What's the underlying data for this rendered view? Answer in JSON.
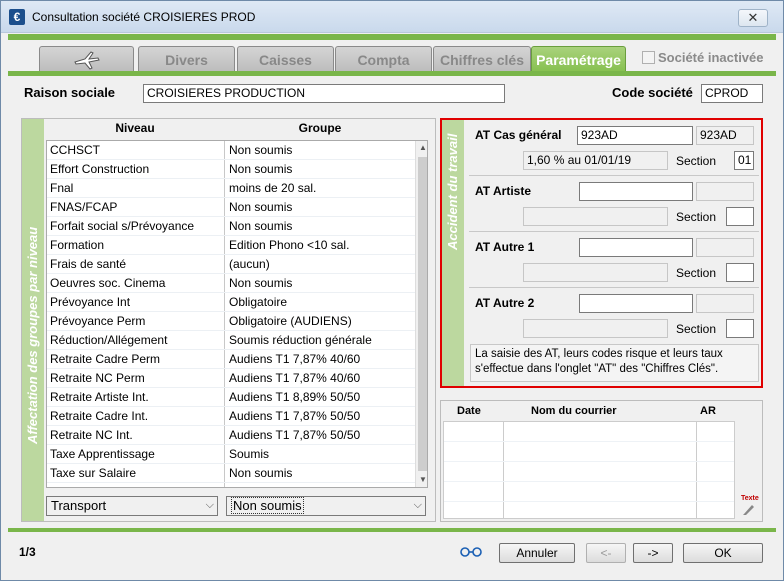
{
  "window": {
    "title": "Consultation société CROISIERES PROD",
    "close_glyph": "✕",
    "app_icon_glyph": "€"
  },
  "tabs": [
    {
      "label": ""
    },
    {
      "label": "Divers"
    },
    {
      "label": "Caisses"
    },
    {
      "label": "Compta"
    },
    {
      "label": "Chiffres clés"
    },
    {
      "label": "Paramétrage"
    }
  ],
  "societe_inactive_label": "Société inactivée",
  "header": {
    "raison_sociale_label": "Raison sociale",
    "raison_sociale_value": "CROISIERES PRODUCTION",
    "code_societe_label": "Code société",
    "code_societe_value": "CPROD"
  },
  "affectation": {
    "side_label": "Affectation des groupes par niveau",
    "col_niveau": "Niveau",
    "col_groupe": "Groupe",
    "rows": [
      {
        "niveau": "CCHSCT",
        "groupe": "Non soumis"
      },
      {
        "niveau": "Effort Construction",
        "groupe": "Non soumis"
      },
      {
        "niveau": "Fnal",
        "groupe": "moins de 20 sal."
      },
      {
        "niveau": "FNAS/FCAP",
        "groupe": "Non soumis"
      },
      {
        "niveau": "Forfait social s/Prévoyance",
        "groupe": "Non soumis"
      },
      {
        "niveau": "Formation",
        "groupe": "Edition Phono <10 sal."
      },
      {
        "niveau": "Frais de santé",
        "groupe": "(aucun)"
      },
      {
        "niveau": "Oeuvres soc. Cinema",
        "groupe": "Non soumis"
      },
      {
        "niveau": "Prévoyance Int",
        "groupe": "Obligatoire"
      },
      {
        "niveau": "Prévoyance Perm",
        "groupe": "Obligatoire (AUDIENS)"
      },
      {
        "niveau": "Réduction/Allégement",
        "groupe": "Soumis réduction générale"
      },
      {
        "niveau": "Retraite  Cadre Perm",
        "groupe": "Audiens T1 7,87% 40/60"
      },
      {
        "niveau": "Retraite  NC Perm",
        "groupe": "Audiens T1 7,87% 40/60"
      },
      {
        "niveau": "Retraite Artiste Int.",
        "groupe": "Audiens T1 8,89% 50/50"
      },
      {
        "niveau": "Retraite Cadre Int.",
        "groupe": "Audiens T1 7,87% 50/50"
      },
      {
        "niveau": "Retraite NC Int.",
        "groupe": "Audiens T1 7,87% 50/50"
      },
      {
        "niveau": "Taxe Apprentissage",
        "groupe": "Soumis"
      },
      {
        "niveau": "Taxe sur Salaire",
        "groupe": "Non soumis"
      },
      {
        "niveau": "Transport",
        "groupe": ""
      }
    ],
    "selected_niveau": "Transport",
    "selected_groupe": "Non soumis"
  },
  "accident": {
    "side_label": "Accident du travail",
    "cas_general_label": "AT Cas général",
    "cas_general_code": "923AD",
    "cas_general_code2": "923AD",
    "cas_general_taux": "1,60 % au 01/01/19",
    "section_label": "Section",
    "cas_general_section": "01",
    "artiste_label": "AT Artiste",
    "autre1_label": "AT Autre 1",
    "autre2_label": "AT Autre 2",
    "note": "La saisie des AT, leurs codes risque et leurs taux s'effectue dans l'onglet \"AT\" des \"Chiffres Clés\"."
  },
  "courrier": {
    "col_date": "Date",
    "col_nom": "Nom du courrier",
    "col_ar": "AR",
    "texte_label": "Texte"
  },
  "footer": {
    "page_indicator": "1/3",
    "annuler": "Annuler",
    "prev": "<-",
    "next": "->",
    "ok": "OK"
  }
}
